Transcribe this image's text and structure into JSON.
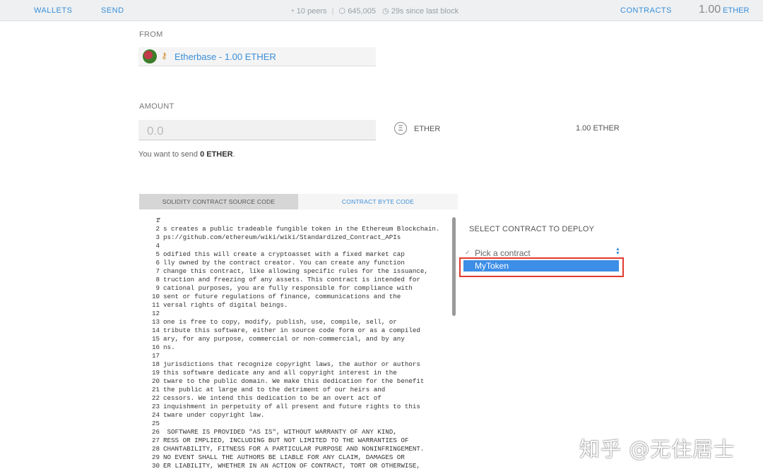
{
  "nav": {
    "wallets": "WALLETS",
    "send": "SEND",
    "contracts": "CONTRACTS",
    "peers": "10 peers",
    "block": "645,005",
    "since": "29s since last block",
    "balance_value": "1.00",
    "balance_unit": "ETHER"
  },
  "from": {
    "label": "FROM",
    "account": "Etherbase - 1.00 ETHER"
  },
  "amount": {
    "label": "AMOUNT",
    "placeholder": "0.0",
    "unit": "ETHER",
    "unit_icon": "Ξ",
    "balance": "1.00 ETHER",
    "send_prefix": "You want to send ",
    "send_value": "0 ETHER",
    "send_suffix": "."
  },
  "tabs": {
    "source": "SOLIDITY CONTRACT SOURCE CODE",
    "bytecode": "CONTRACT BYTE CODE"
  },
  "editor": {
    "lines": [
      {
        "n": "1",
        "t": ""
      },
      {
        "n": "2",
        "t": "s creates a public tradeable fungible token in the Ethereum Blockchain."
      },
      {
        "n": "3",
        "t": "ps://github.com/ethereum/wiki/wiki/Standardized_Contract_APIs"
      },
      {
        "n": "4",
        "t": ""
      },
      {
        "n": "5",
        "t": "odified this will create a cryptoasset with a fixed market cap"
      },
      {
        "n": "6",
        "t": "lly owned by the contract creator. You can create any function"
      },
      {
        "n": "7",
        "t": "change this contract, like allowing specific rules for the issuance,"
      },
      {
        "n": "8",
        "t": "truction and freezing of any assets. This contract is intended for"
      },
      {
        "n": "9",
        "t": "cational purposes, you are fully responsible for compliance with"
      },
      {
        "n": "10",
        "t": "sent or future regulations of finance, communications and the"
      },
      {
        "n": "11",
        "t": "versal rights of digital beings."
      },
      {
        "n": "12",
        "t": ""
      },
      {
        "n": "13",
        "t": "one is free to copy, modify, publish, use, compile, sell, or"
      },
      {
        "n": "14",
        "t": "tribute this software, either in source code form or as a compiled"
      },
      {
        "n": "15",
        "t": "ary, for any purpose, commercial or non-commercial, and by any"
      },
      {
        "n": "16",
        "t": "ns."
      },
      {
        "n": "17",
        "t": ""
      },
      {
        "n": "18",
        "t": "jurisdictions that recognize copyright laws, the author or authors"
      },
      {
        "n": "19",
        "t": "this software dedicate any and all copyright interest in the"
      },
      {
        "n": "20",
        "t": "tware to the public domain. We make this dedication for the benefit"
      },
      {
        "n": "21",
        "t": "the public at large and to the detriment of our heirs and"
      },
      {
        "n": "22",
        "t": "cessors. We intend this dedication to be an overt act of"
      },
      {
        "n": "23",
        "t": "inquishment in perpetuity of all present and future rights to this"
      },
      {
        "n": "24",
        "t": "tware under copyright law."
      },
      {
        "n": "25",
        "t": ""
      },
      {
        "n": "26",
        "t": " SOFTWARE IS PROVIDED \"AS IS\", WITHOUT WARRANTY OF ANY KIND,"
      },
      {
        "n": "27",
        "t": "RESS OR IMPLIED, INCLUDING BUT NOT LIMITED TO THE WARRANTIES OF"
      },
      {
        "n": "28",
        "t": "CHANTABILITY, FITNESS FOR A PARTICULAR PURPOSE AND NONINFRINGEMENT."
      },
      {
        "n": "29",
        "t": "NO EVENT SHALL THE AUTHORS BE LIABLE FOR ANY CLAIM, DAMAGES OR"
      },
      {
        "n": "30",
        "t": "ER LIABILITY, WHETHER IN AN ACTION OF CONTRACT, TORT OR OTHERWISE,"
      }
    ]
  },
  "deploy": {
    "label": "SELECT CONTRACT TO DEPLOY",
    "placeholder": "Pick a contract",
    "selected": "MyToken"
  },
  "watermark": "知乎 @无住居士",
  "colors": {
    "accent": "#3a8fd8",
    "selection": "#3d8ee6",
    "highlight_border": "#e03a2f"
  },
  "icons": {
    "peers": "signal-icon",
    "block": "cube-icon",
    "time": "clock-icon",
    "key": "key-icon",
    "ether": "ether-icon"
  }
}
